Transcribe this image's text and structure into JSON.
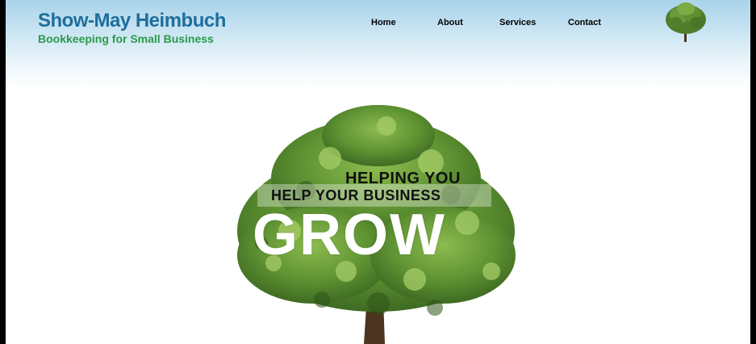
{
  "header": {
    "brand_name": "Show-May Heimbuch",
    "tagline": "Bookkeeping for Small Business"
  },
  "nav": {
    "items": [
      {
        "label": "Home"
      },
      {
        "label": "About"
      },
      {
        "label": "Services"
      },
      {
        "label": "Contact"
      }
    ]
  },
  "hero": {
    "line1": "HELPING YOU",
    "line2": "HELP YOUR BUSINESS",
    "big_word": "GROW"
  },
  "colors": {
    "brand_blue": "#1d6e9c",
    "tagline_green": "#2a9a4a",
    "header_gradient_top": "#a9d3ea"
  },
  "icons": {
    "logo": "tree-icon",
    "hero": "large-tree-image"
  }
}
